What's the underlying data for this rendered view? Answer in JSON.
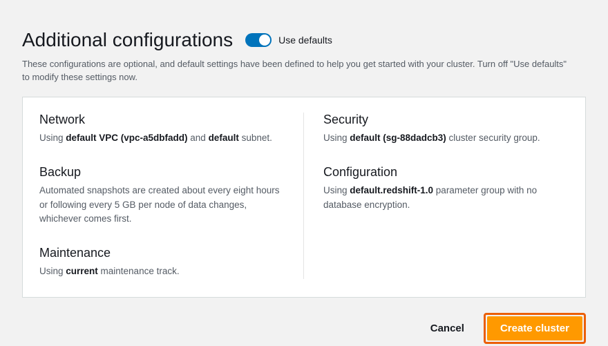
{
  "header": {
    "title": "Additional configurations",
    "toggle_label": "Use defaults"
  },
  "description": "These configurations are optional, and default settings have been defined to help you get started with your cluster. Turn off \"Use defaults\" to modify these settings now.",
  "network": {
    "title": "Network",
    "using": "Using ",
    "default_vpc_label": "default VPC (vpc-a5dbfadd)",
    "and": " and ",
    "default_subnet_label": "default",
    "suffix": " subnet."
  },
  "backup": {
    "title": "Backup",
    "desc": "Automated snapshots are created about every eight hours or following every 5 GB per node of data changes, whichever comes first."
  },
  "maintenance": {
    "title": "Maintenance",
    "using": "Using ",
    "bold": "current",
    "suffix": " maintenance track."
  },
  "security": {
    "title": "Security",
    "using": "Using ",
    "bold": "default (sg-88dadcb3)",
    "suffix": " cluster security group."
  },
  "configuration": {
    "title": "Configuration",
    "using": "Using ",
    "bold": "default.redshift-1.0",
    "suffix": " parameter group with no database encryption."
  },
  "footer": {
    "cancel": "Cancel",
    "create": "Create cluster"
  }
}
